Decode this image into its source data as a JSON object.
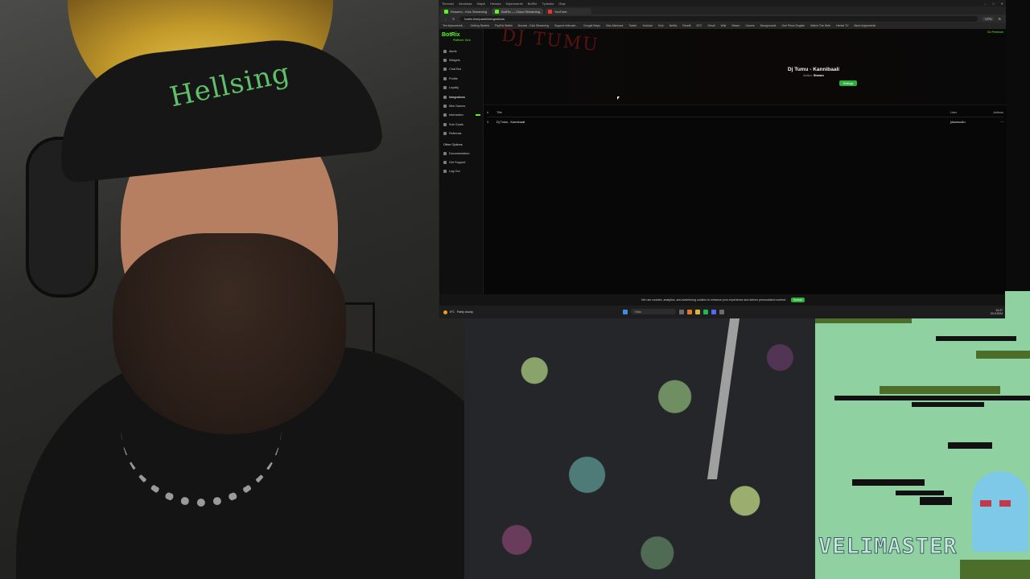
{
  "browser": {
    "titlebar_items": [
      "Tiedosto",
      "Muokkaa",
      "Näytä",
      "Historia",
      "Kirjanmerkit",
      "BotRix",
      "Työkalut",
      "Ohje"
    ],
    "tabs": [
      {
        "label": "Rossmo - Kick Streaming"
      },
      {
        "label": "BotRix — Cloud Streaming"
      },
      {
        "label": "YouTube"
      }
    ],
    "address": "botrix.live/panel/integrations",
    "vpn_label": "VPN",
    "bookmarks": [
      "Tee kirjanmerkit...",
      "Getting Started",
      "PayPal Wallet",
      "Browse - Kick Streaming",
      "Support mikroskr...",
      "Google Maps",
      "Hiss Mahmud",
      "Twitch",
      "Youtube",
      "Kick",
      "Netflix",
      "Reddit",
      "BTC",
      "Gmail",
      "Wiki",
      "Steam",
      "Games",
      "Newgrounds",
      "One Piece English",
      "Watch The Web",
      "Hentai TV",
      "Muut kirjanmerkit"
    ]
  },
  "app": {
    "logo": "BotRix",
    "logo_sub": "Platform: Kick",
    "go_premium": "Go Premium",
    "nav_items": [
      {
        "label": "Alerts"
      },
      {
        "label": "Widgets"
      },
      {
        "label": "Chat Bot"
      },
      {
        "label": "Profile"
      },
      {
        "label": "Loyalty"
      },
      {
        "label": "Integrations"
      },
      {
        "label": "Mini Games"
      },
      {
        "label": "Interaction"
      },
      {
        "label": "Sub Goals"
      },
      {
        "label": "Referrals"
      }
    ],
    "other_options_label": "Other Options",
    "other_items": [
      {
        "label": "Documentation"
      },
      {
        "label": "Get Support"
      },
      {
        "label": "Log Out"
      }
    ],
    "hero": {
      "art_text": "DJ TUMU",
      "title": "Dj Tumu - Kannibaali",
      "action_label": "Action:",
      "action_value": "Stream",
      "button_label": "Settings"
    },
    "table": {
      "headers": {
        "num": "#",
        "title": "Title",
        "user": "User",
        "actions": "Actions"
      },
      "rows": [
        {
          "num": "1",
          "title": "Dj Tumu - Kannibaali",
          "user": "jokumuuttu",
          "actions": "⋯"
        }
      ]
    },
    "cookie": {
      "text": "We use cookies, analytics, and advertising cookies to enhance your experience and deliver personalized content.",
      "button": "Accept"
    }
  },
  "taskbar": {
    "weather_temp": "6°C",
    "weather_desc": "Partly cloudy",
    "search_placeholder": "Haku",
    "time": "13.27",
    "date": "24.3.2024"
  },
  "overlay": {
    "brand_text": "VELIMASTER",
    "cap_text": "Hellsing"
  },
  "colors": {
    "kick_green": "#53fc18",
    "button_green": "#2fae3b",
    "game_bg": "#8fd1a1"
  }
}
